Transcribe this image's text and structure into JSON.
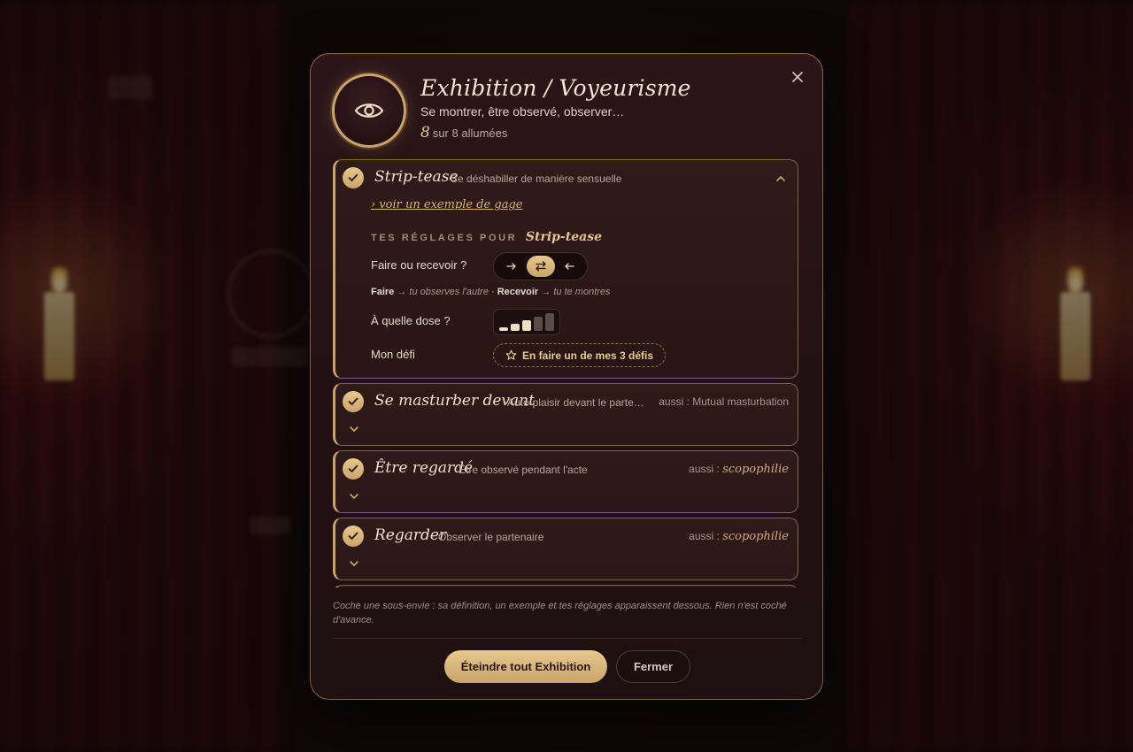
{
  "modal": {
    "title": "Exhibition / Voyeurisme",
    "subtitle": "Se montrer, être observé, observer…",
    "counter_value": "8",
    "counter_suffix": "sur 8 allumées",
    "emblem_icon": "eye-icon",
    "close_icon": "close-icon"
  },
  "items": [
    {
      "title": "Strip-tease",
      "desc": "Se déshabiller de manière sensuelle",
      "checked": true,
      "expanded": true,
      "example_link": "› voir un exemple de gage",
      "settings_heading": "TES RÉGLAGES POUR",
      "settings_name": "Strip-tease",
      "direction_label": "Faire ou recevoir ?",
      "direction_options": [
        "do",
        "both",
        "receive"
      ],
      "direction_selected": "both",
      "hint_do": "Faire",
      "hint_do_text": "→ tu observes l'autre ·",
      "hint_receive": "Recevoir",
      "hint_receive_text": "→ tu te montres",
      "dose_label": "À quelle dose ?",
      "dose_level": 3,
      "dose_max": 5,
      "challenge_label": "Mon défi",
      "challenge_button": "En faire un de mes 3 défis"
    },
    {
      "title": "Se masturber devant",
      "desc": "Auto-plaisir devant le parte…",
      "aka_prefix": "aussi : Mutual masturbation",
      "checked": true
    },
    {
      "title": "Être regardé",
      "desc": "Être observé pendant l'acte",
      "aka_prefix": "aussi :",
      "aka_value": "scopophilie",
      "checked": true
    },
    {
      "title": "Regarder",
      "desc": "Observer le partenaire",
      "aka_prefix": "aussi :",
      "aka_value": "scopophilie",
      "checked": true
    }
  ],
  "footer": {
    "note": "Coche une sous-envie : sa définition, un exemple et tes réglages apparaissent dessous. Rien n'est coché d'avance.",
    "primary_button": "Éteindre tout Exhibition",
    "secondary_button": "Fermer"
  },
  "colors": {
    "accent_gold": "#c9a46a",
    "modal_bg": "#221113",
    "text_light": "#f2e2cf"
  }
}
